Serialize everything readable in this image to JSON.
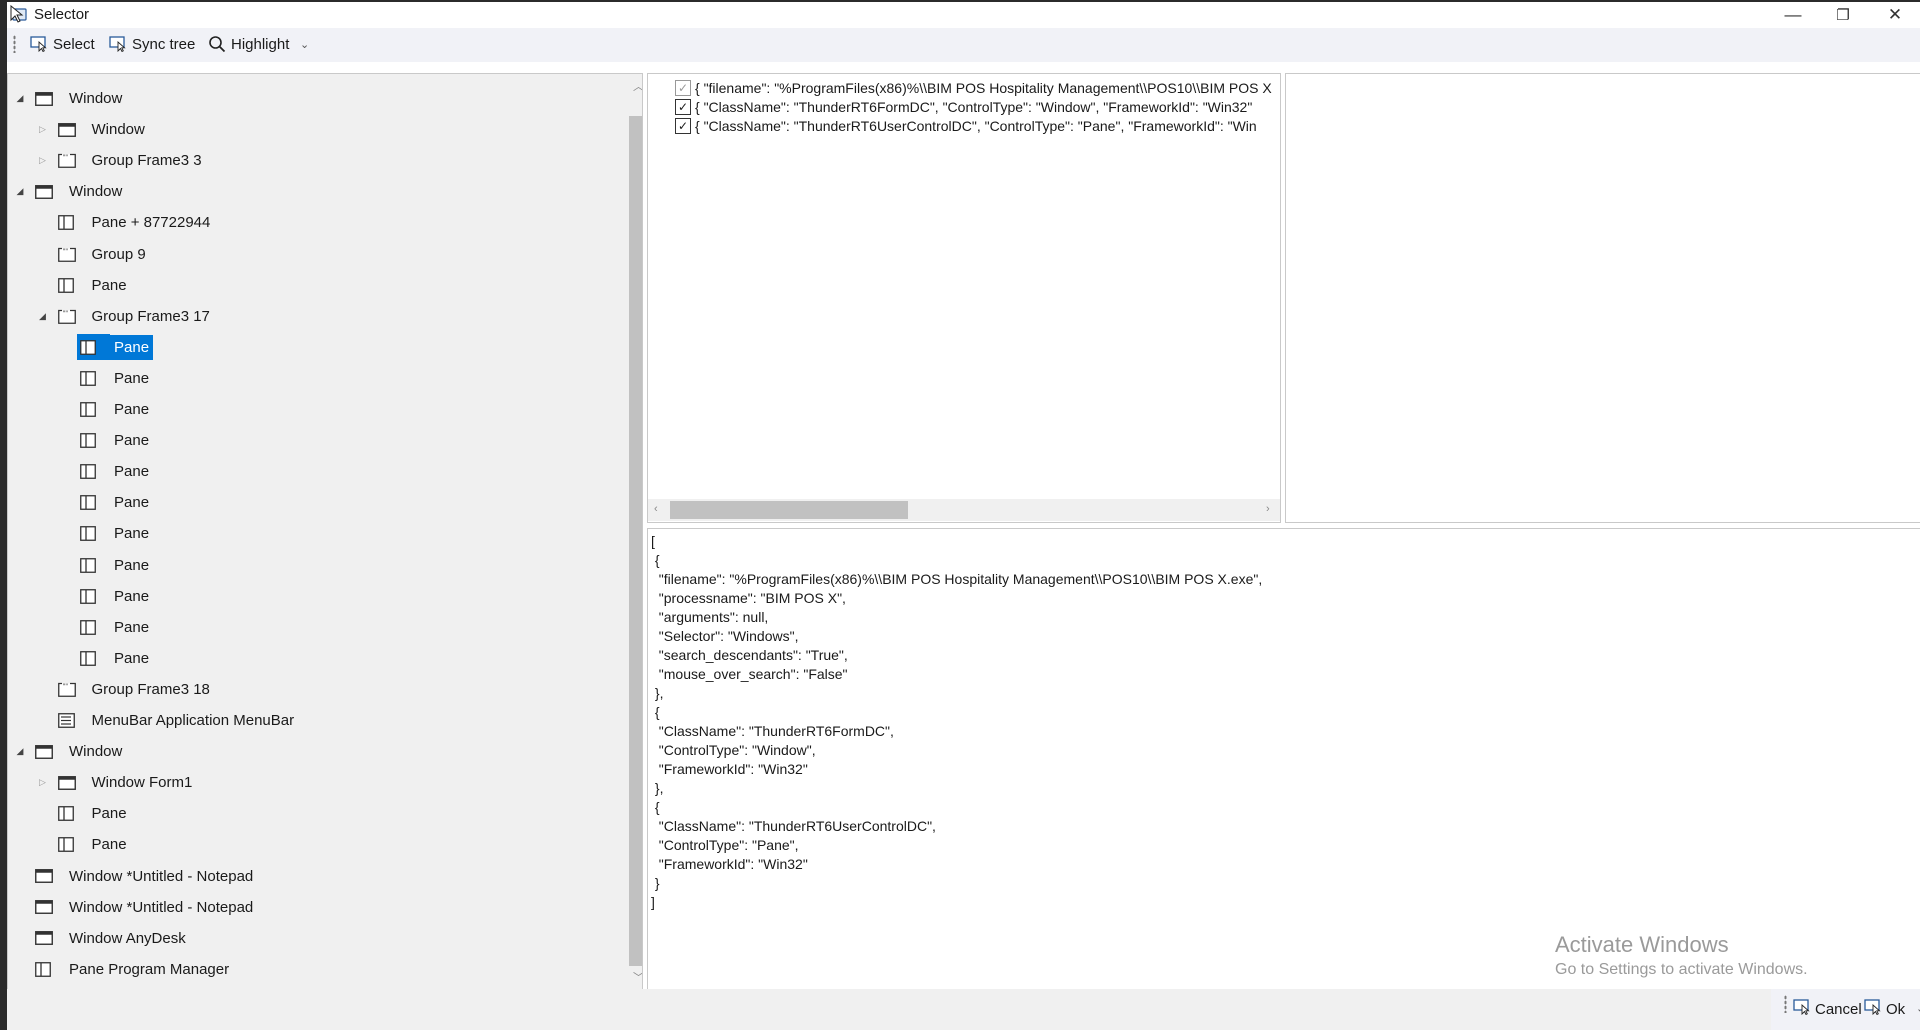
{
  "window": {
    "title": "Selector",
    "controls": {
      "minimize": "—",
      "restore": "❐",
      "close": "✕"
    }
  },
  "toolbar": {
    "select_label": "Select",
    "sync_label": "Sync tree",
    "highlight_label": "Highlight"
  },
  "tree": {
    "items": [
      {
        "label": "Window",
        "level": 0,
        "expander": "expanded",
        "icon": "window-icon"
      },
      {
        "label": "Window",
        "level": 1,
        "expander": "collapsed",
        "icon": "window-icon"
      },
      {
        "label": "Group Frame3 3",
        "level": 1,
        "expander": "collapsed",
        "icon": "group-icon"
      },
      {
        "label": "Window",
        "level": 0,
        "expander": "expanded",
        "icon": "window-icon"
      },
      {
        "label": "Pane + 87722944",
        "level": 1,
        "expander": "none",
        "icon": "pane-icon"
      },
      {
        "label": "Group  9",
        "level": 1,
        "expander": "none",
        "icon": "group-icon"
      },
      {
        "label": "Pane",
        "level": 1,
        "expander": "none",
        "icon": "pane-icon"
      },
      {
        "label": "Group Frame3 17",
        "level": 1,
        "expander": "expanded",
        "icon": "group-icon"
      },
      {
        "label": "Pane",
        "level": 2,
        "expander": "none",
        "icon": "pane-icon",
        "selected": true
      },
      {
        "label": "Pane",
        "level": 2,
        "expander": "none",
        "icon": "pane-icon"
      },
      {
        "label": "Pane",
        "level": 2,
        "expander": "none",
        "icon": "pane-icon"
      },
      {
        "label": "Pane",
        "level": 2,
        "expander": "none",
        "icon": "pane-icon"
      },
      {
        "label": "Pane",
        "level": 2,
        "expander": "none",
        "icon": "pane-icon"
      },
      {
        "label": "Pane",
        "level": 2,
        "expander": "none",
        "icon": "pane-icon"
      },
      {
        "label": "Pane",
        "level": 2,
        "expander": "none",
        "icon": "pane-icon"
      },
      {
        "label": "Pane",
        "level": 2,
        "expander": "none",
        "icon": "pane-icon"
      },
      {
        "label": "Pane",
        "level": 2,
        "expander": "none",
        "icon": "pane-icon"
      },
      {
        "label": "Pane",
        "level": 2,
        "expander": "none",
        "icon": "pane-icon"
      },
      {
        "label": "Pane",
        "level": 2,
        "expander": "none",
        "icon": "pane-icon"
      },
      {
        "label": "Group Frame3 18",
        "level": 1,
        "expander": "none",
        "icon": "group-icon"
      },
      {
        "label": "MenuBar Application MenuBar",
        "level": 1,
        "expander": "none",
        "icon": "menubar-icon"
      },
      {
        "label": "Window",
        "level": 0,
        "expander": "expanded",
        "icon": "window-icon"
      },
      {
        "label": "Window Form1",
        "level": 1,
        "expander": "collapsed",
        "icon": "window-icon"
      },
      {
        "label": "Pane",
        "level": 1,
        "expander": "none",
        "icon": "pane-icon"
      },
      {
        "label": "Pane",
        "level": 1,
        "expander": "none",
        "icon": "pane-icon"
      },
      {
        "label": "Window *Untitled - Notepad",
        "level": 0,
        "expander": "none",
        "icon": "window-icon"
      },
      {
        "label": "Window *Untitled - Notepad",
        "level": 0,
        "expander": "none",
        "icon": "window-icon"
      },
      {
        "label": "Window AnyDesk",
        "level": 0,
        "expander": "none",
        "icon": "window-icon"
      },
      {
        "label": "Pane Program Manager",
        "level": 0,
        "expander": "none",
        "icon": "pane-icon"
      }
    ]
  },
  "selectors": [
    {
      "checked": true,
      "dim": true,
      "text": "{  \"filename\": \"%ProgramFiles(x86)%\\\\BIM POS Hospitality Management\\\\POS10\\\\BIM POS X"
    },
    {
      "checked": true,
      "dim": false,
      "text": "{  \"ClassName\": \"ThunderRT6FormDC\",   \"ControlType\": \"Window\",   \"FrameworkId\": \"Win32\""
    },
    {
      "checked": true,
      "dim": false,
      "text": "{  \"ClassName\": \"ThunderRT6UserControlDC\",   \"ControlType\": \"Pane\",   \"FrameworkId\": \"Win"
    }
  ],
  "json_text": "[\n {\n  \"filename\": \"%ProgramFiles(x86)%\\\\BIM POS Hospitality Management\\\\POS10\\\\BIM POS X.exe\",\n  \"processname\": \"BIM POS X\",\n  \"arguments\": null,\n  \"Selector\": \"Windows\",\n  \"search_descendants\": \"True\",\n  \"mouse_over_search\": \"False\"\n },\n {\n  \"ClassName\": \"ThunderRT6FormDC\",\n  \"ControlType\": \"Window\",\n  \"FrameworkId\": \"Win32\"\n },\n {\n  \"ClassName\": \"ThunderRT6UserControlDC\",\n  \"ControlType\": \"Pane\",\n  \"FrameworkId\": \"Win32\"\n }\n]",
  "watermark": {
    "line1": "Activate Windows",
    "line2": "Go to Settings to activate Windows."
  },
  "footer": {
    "cancel_label": "Cancel",
    "ok_label": "Ok"
  },
  "colors": {
    "selection": "#0078d7",
    "toolbar_bg": "#f1f2f7",
    "panel_bg": "#f0f0f0"
  }
}
